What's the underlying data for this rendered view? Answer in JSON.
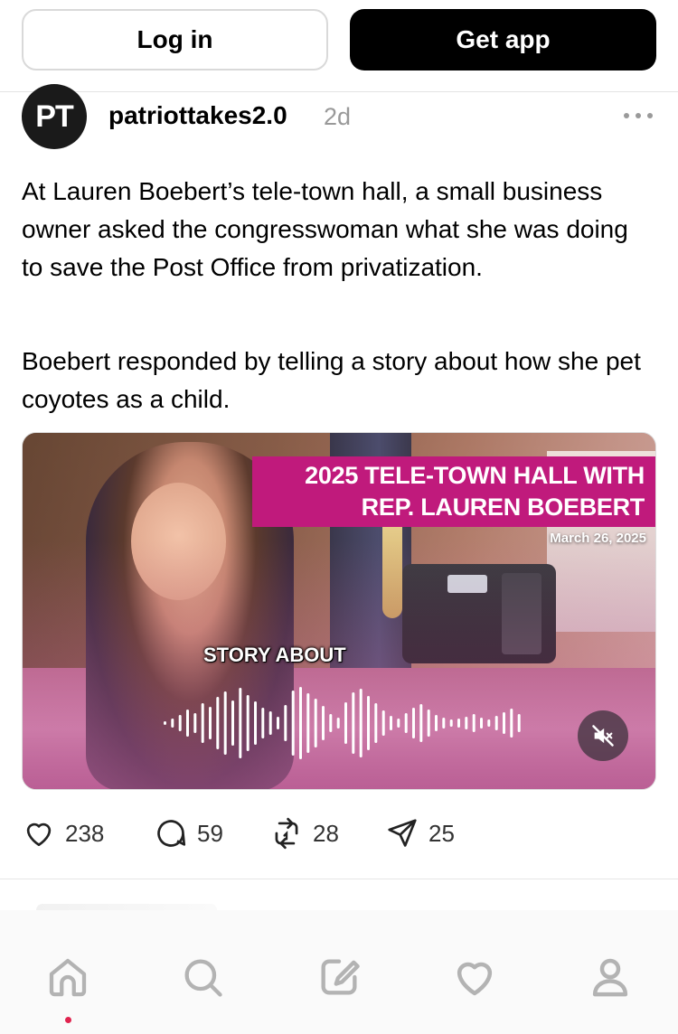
{
  "header": {
    "login_label": "Log in",
    "getapp_label": "Get app"
  },
  "post": {
    "avatar_text": "PT",
    "username": "patriottakes2.0",
    "time_ago": "2d",
    "paragraphs": [
      "At Lauren Boebert’s tele-town hall, a small business owner asked the congresswoman what she was doing to save the Post Office from privatization.",
      "Boebert responded by telling a story about how she pet coyotes as a child."
    ],
    "video": {
      "banner_line1": "2025 TELE-TOWN HALL WITH",
      "banner_line2": "REP. LAUREN BOEBERT",
      "date": "March 26, 2025",
      "caption": "STORY ABOUT",
      "muted": true
    },
    "actions": {
      "likes": "238",
      "replies": "59",
      "reposts": "28",
      "shares": "25"
    }
  },
  "bottom_nav": {
    "items": [
      "home-icon",
      "search-icon",
      "compose-icon",
      "heart-icon",
      "profile-icon"
    ],
    "active": "home-icon"
  },
  "colors": {
    "banner": "#c01a7c",
    "active_dot": "#e0234e",
    "icon_gray": "#b3b3b3"
  }
}
